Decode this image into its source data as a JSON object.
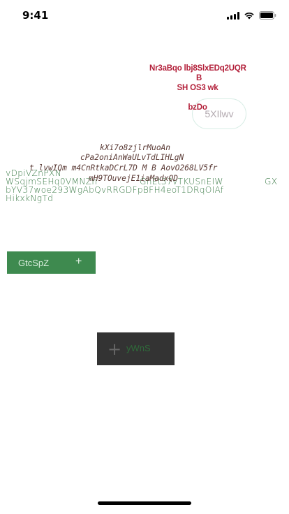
{
  "status_bar": {
    "time": "9:41"
  },
  "red_text": {
    "line1": "Nr3aBqo lbj8SlxEDq2UQR",
    "line2": "B",
    "line3": "SH OS3 wk",
    "line4": "bzDo"
  },
  "pill_button": {
    "label": "5XIlwv"
  },
  "mono_text": {
    "line1": "kXi7o8zjlrMuoAn",
    "line2": "cPa2oniAnWaULvTdLIHLgN",
    "line3": "t lvwIQm m4CnRtkaDCrL7D M B AovO268LV5fr",
    "line4": "mH9TOuvejE1iaMadxQD"
  },
  "green_text": {
    "line1": "vDpiVZnPXN",
    "line2a": "WSqjmSEHq0VMNZn",
    "line2b": "GnEt37vTKUSnEIW",
    "line2c": "GX",
    "line3": "bYV37woe293WgAbQvRRGDFpBFH4eoT1DRqOIAf",
    "line4": "HikxkNgTd"
  },
  "green_button": {
    "label": "GtcSpZ",
    "icon": "+"
  },
  "dark_button": {
    "icon": "+",
    "label": "yWnS"
  },
  "colors": {
    "red_text": "#b3203a",
    "mono_text": "#5a3a35",
    "green_text": "#3a7a46",
    "green_button": "#3e8a4f",
    "dark_button": "#333333"
  }
}
